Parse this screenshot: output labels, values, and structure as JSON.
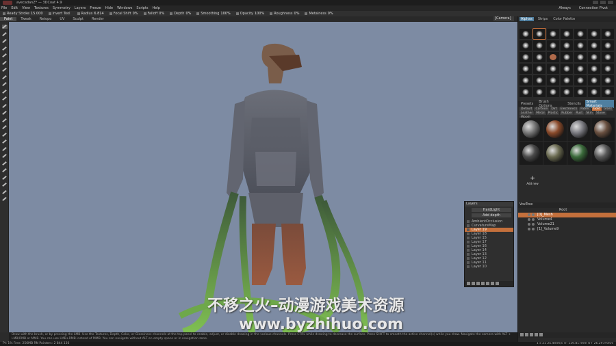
{
  "window": {
    "title": "avecadanZ* — 3DCoat 4.9"
  },
  "menu": [
    "File",
    "Edit",
    "View",
    "Textures",
    "Symmetry",
    "Layers",
    "Freeze",
    "Hide",
    "Windows",
    "Scripts",
    "Help"
  ],
  "menu_right": [
    "Always",
    "Connection Pivot"
  ],
  "tool_options": [
    {
      "label": "Ready Stroke",
      "value": "15.000"
    },
    {
      "label": "Invert Tool",
      "value": ""
    },
    {
      "label": "Radius",
      "value": "6.814"
    },
    {
      "label": "Focal Shift",
      "value": "0%"
    },
    {
      "label": "Falloff",
      "value": "0%"
    },
    {
      "label": "Depth",
      "value": "0%"
    },
    {
      "label": "Smoothing",
      "value": "100%"
    },
    {
      "label": "Opacity",
      "value": "100%"
    },
    {
      "label": "Roughness",
      "value": "0%"
    },
    {
      "label": "Metalness",
      "value": "0%"
    }
  ],
  "room_tabs": [
    "Paint",
    "Tweak",
    "Retopo",
    "UV",
    "Sculpt",
    "Render"
  ],
  "room_active": "Paint",
  "right_panel": {
    "camera": "[Camera]",
    "tabs": [
      "Alphas",
      "Strips",
      "Color Palette"
    ],
    "tabs_active": "Alphas",
    "preset_tabs": [
      "Presets",
      "Brush Options",
      "Stencils",
      "Smart Materials"
    ],
    "preset_active": "Smart Materials",
    "material_tags": [
      "Default",
      "Cartoon",
      "Dirt",
      "Electronics",
      "Fabric",
      "Gold",
      "Glass",
      "Leather",
      "Metal",
      "Plastic",
      "Rubber",
      "Rust",
      "Skin",
      "Stone",
      "Wood"
    ],
    "material_tag_active": "Gold",
    "material_add_label": "Add new",
    "materials_colors": [
      "#777777",
      "#8a4a2a",
      "#7a7a80",
      "#6a5040",
      "#4a4a4a",
      "#6a6a50",
      "#3a6a3a",
      "#5a5a5a"
    ]
  },
  "layers_panel": {
    "title": "Layers",
    "blend_mode": "HardLight",
    "depth_mode": "Add depth",
    "items": [
      "AmbientOcclusion",
      "CurvatureMap",
      "Layer 19",
      "Layer 18",
      "Layer 15",
      "Layer 17",
      "Layer 16",
      "Layer 14",
      "Layer 13",
      "Layer 12",
      "Layer 11",
      "Layer 10"
    ],
    "active": "Layer 19"
  },
  "voxtree": {
    "title": "VoxTree",
    "root": "Root",
    "items": [
      "[0]_Mesh",
      "Volume4",
      "Volume21",
      "[1]_Volume9"
    ],
    "active": "[0]_Mesh"
  },
  "watermark": {
    "line1": "不移之火–动漫游戏美术资源",
    "line2": "www.byzhihuo.com"
  },
  "hint_text": "Draw with the brush, or by pressing the LMB. Use the Textures, Depth, Color, or Glossiness channels at the top panel to enable, adjust, or disable drawing in the various channels. Press CTRL while drawing to decrease the surface. Press SHIFT to smooth the active channel(s) while you draw. Navigate the camera with ALT + LMB/RMB or MMB. You can use LMB+RMB instead of MMB. You can navigate without ALT on empty space or in navigation zone.",
  "status": {
    "left": "Pt: 1%   Free: 256MB   RN Pointers: 2 844 136",
    "right": "1 x 21 25.4mm/s   Tr: 119.817mm   U+ 26.297mm/s"
  }
}
